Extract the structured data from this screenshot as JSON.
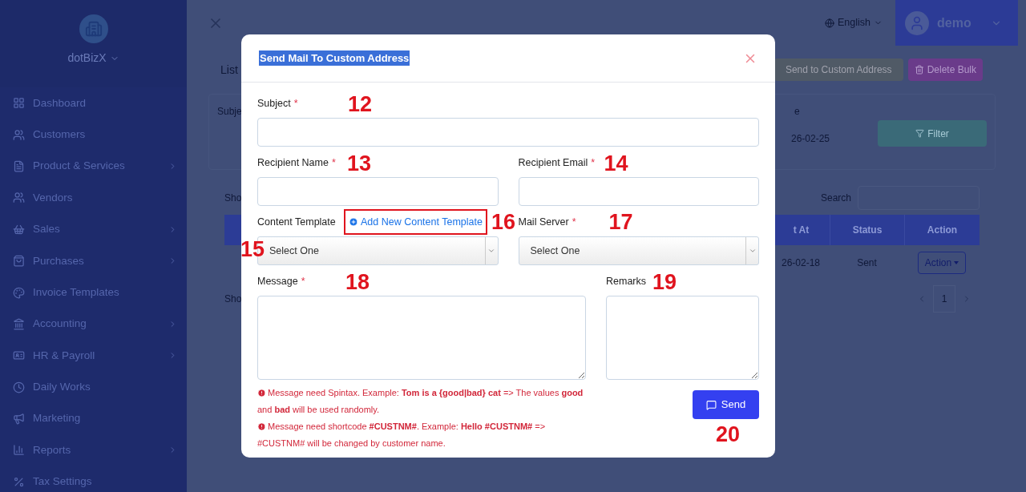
{
  "sidebar": {
    "brand": "dotBizX",
    "items": [
      {
        "label": "Dashboard",
        "has_submenu": false
      },
      {
        "label": "Customers",
        "has_submenu": false
      },
      {
        "label": "Product & Services",
        "has_submenu": true
      },
      {
        "label": "Vendors",
        "has_submenu": false
      },
      {
        "label": "Sales",
        "has_submenu": true
      },
      {
        "label": "Purchases",
        "has_submenu": true
      },
      {
        "label": "Invoice Templates",
        "has_submenu": false
      },
      {
        "label": "Accounting",
        "has_submenu": true
      },
      {
        "label": "HR & Payroll",
        "has_submenu": true
      },
      {
        "label": "Daily Works",
        "has_submenu": false
      },
      {
        "label": "Marketing",
        "has_submenu": false
      },
      {
        "label": "Reports",
        "has_submenu": true
      },
      {
        "label": "Tax Settings",
        "has_submenu": false
      }
    ]
  },
  "topbar": {
    "language": "English",
    "user": "demo"
  },
  "page": {
    "heading": "List",
    "buttons": [
      "Send to Custom Address",
      "Delete Bulk"
    ],
    "filter": {
      "label_1": "Subje",
      "label_2": "e",
      "date": "26-02-25",
      "button": "Filter"
    },
    "table": {
      "show_top": "Sho",
      "search_label": "Search",
      "columns": [
        "t At",
        "Status",
        "Action"
      ],
      "rows": [
        {
          "cells": [
            "26-02-18",
            "Sent"
          ],
          "action": "Action"
        }
      ],
      "show_bottom": "Sho",
      "page": "1"
    }
  },
  "modal": {
    "title": "Send Mail To Custom Address",
    "fields": [
      {
        "kind": "text",
        "label": "Subject",
        "required_mark": "*",
        "marker": "12"
      },
      {
        "kind": "text",
        "label": "Recipient Name",
        "required_mark": "*",
        "marker": "13"
      },
      {
        "kind": "text",
        "label": "Recipient Email",
        "required_mark": "*",
        "marker": "14"
      },
      {
        "kind": "select",
        "label": "Content Template",
        "value": "Select One",
        "marker": "15",
        "link": "Add New Content Template",
        "link_marker": "16"
      },
      {
        "kind": "select",
        "label": "Mail Server",
        "required_mark": "*",
        "value": "Select One",
        "marker": "17"
      },
      {
        "kind": "textarea",
        "label": "Message",
        "required_mark": "*",
        "marker": "18"
      },
      {
        "kind": "textarea",
        "label": "Remarks",
        "marker": "19"
      }
    ],
    "notes": [
      "Message need Spintax. Example: **Tom is a {good|bad} cat** => The values **good** and **bad** will be used randomly.",
      "Message need shortcode **#CUSTNM#**. Example: **Hello #CUSTNM#** => #CUSTNM# will be changed by customer name."
    ],
    "send": {
      "label": "Send",
      "marker": "20"
    }
  }
}
